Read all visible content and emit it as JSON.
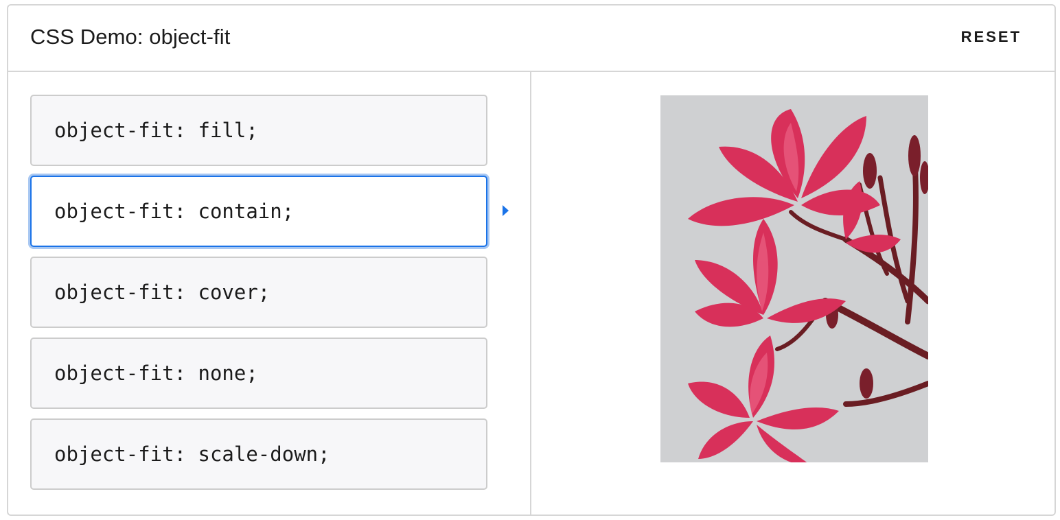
{
  "header": {
    "title": "CSS Demo: object-fit",
    "reset_label": "RESET"
  },
  "options": [
    {
      "code": "object-fit: fill;",
      "selected": false
    },
    {
      "code": "object-fit: contain;",
      "selected": true
    },
    {
      "code": "object-fit: cover;",
      "selected": false
    },
    {
      "code": "object-fit: none;",
      "selected": false
    },
    {
      "code": "object-fit: scale-down;",
      "selected": false
    }
  ],
  "output": {
    "image_subject": "pink plumeria flowers on branch",
    "background_color": "#cfd0d2",
    "petal_color": "#d8305a",
    "stem_color": "#6a1d23"
  },
  "colors": {
    "accent": "#1a73e8",
    "border": "#d6d6d6",
    "option_bg": "#f7f7f9"
  }
}
